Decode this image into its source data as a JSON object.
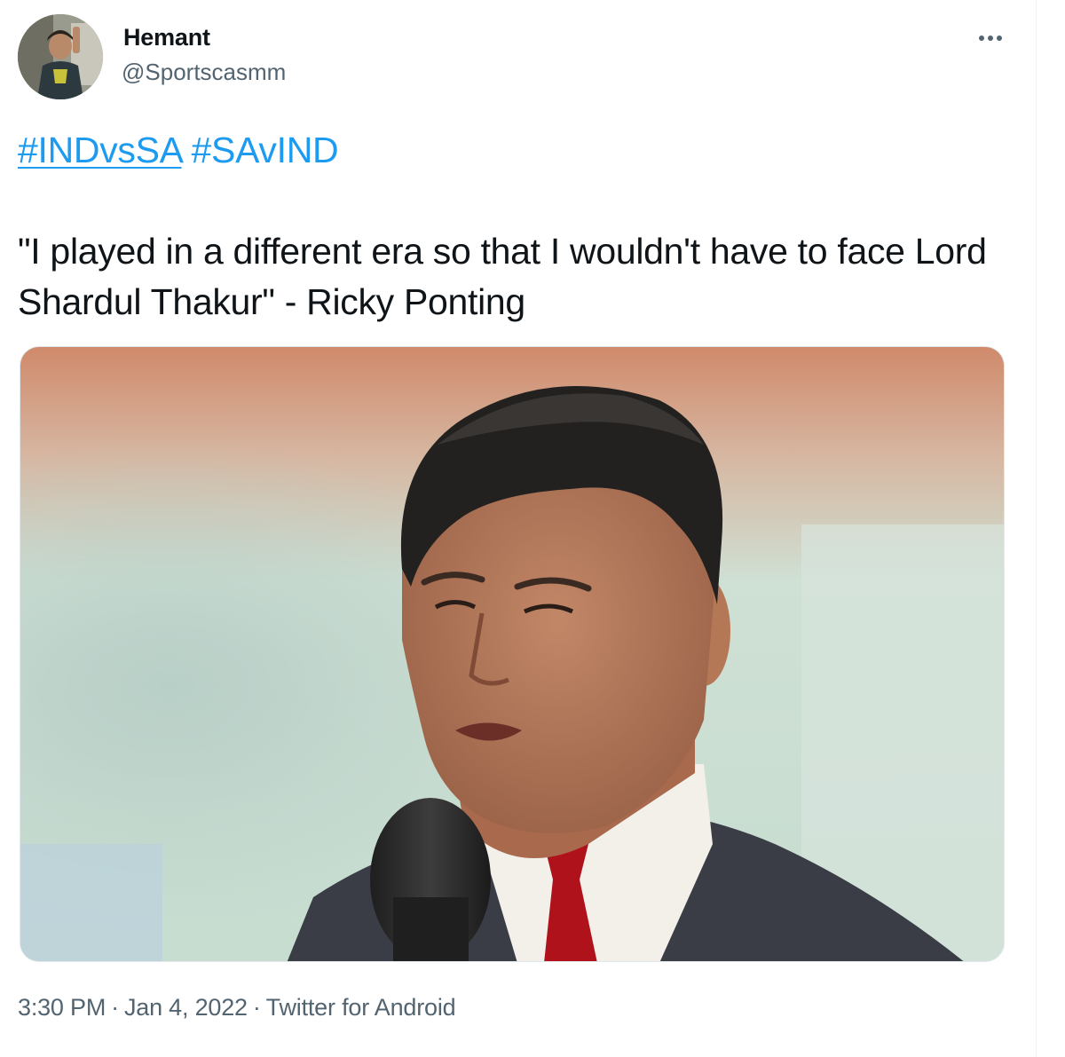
{
  "author": {
    "name": "Hemant",
    "handle": "@Sportscasmm"
  },
  "tweet": {
    "hashtags": [
      "#INDvsSA",
      "#SAvIND"
    ],
    "text": "\"I played in a different era so that I wouldn't have to face Lord Shardul Thakur\" - Ricky Ponting"
  },
  "meta": {
    "time": "3:30 PM",
    "separator": "·",
    "date": "Jan 4, 2022",
    "source": "Twitter for Android"
  },
  "icons": {
    "more": "more-horizontal-icon"
  },
  "colors": {
    "link": "#1d9bf0",
    "secondary_text": "#536471",
    "primary_text": "#0f1419"
  }
}
